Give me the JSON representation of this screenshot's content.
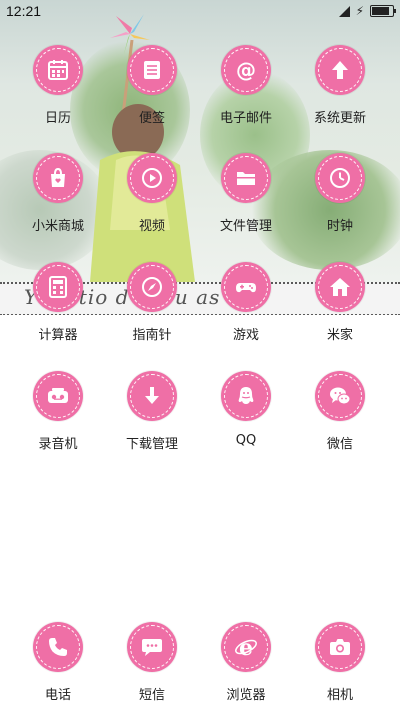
{
  "status_bar": {
    "time": "12:21",
    "battery_level": 0.85
  },
  "wallpaper": {
    "strip_text": "Y    statio   d  rel    u  as     e"
  },
  "apps": [
    {
      "label": "日历",
      "icon": "calendar-icon"
    },
    {
      "label": "便签",
      "icon": "notes-icon"
    },
    {
      "label": "电子邮件",
      "icon": "email-icon"
    },
    {
      "label": "系统更新",
      "icon": "update-icon"
    },
    {
      "label": "小米商城",
      "icon": "shopping-bag-icon"
    },
    {
      "label": "视频",
      "icon": "video-icon"
    },
    {
      "label": "文件管理",
      "icon": "folder-icon"
    },
    {
      "label": "时钟",
      "icon": "clock-icon"
    },
    {
      "label": "计算器",
      "icon": "calculator-icon"
    },
    {
      "label": "指南针",
      "icon": "compass-icon"
    },
    {
      "label": "游戏",
      "icon": "gamepad-icon"
    },
    {
      "label": "米家",
      "icon": "home-icon"
    },
    {
      "label": "录音机",
      "icon": "recorder-icon"
    },
    {
      "label": "下载管理",
      "icon": "download-icon"
    },
    {
      "label": "QQ",
      "icon": "qq-icon"
    },
    {
      "label": "微信",
      "icon": "wechat-icon"
    }
  ],
  "dock": [
    {
      "label": "电话",
      "icon": "phone-icon"
    },
    {
      "label": "短信",
      "icon": "message-icon"
    },
    {
      "label": "浏览器",
      "icon": "browser-icon"
    },
    {
      "label": "相机",
      "icon": "camera-icon"
    }
  ],
  "colors": {
    "icon_bg": "#ef6fa6",
    "label_text": "#222222"
  }
}
